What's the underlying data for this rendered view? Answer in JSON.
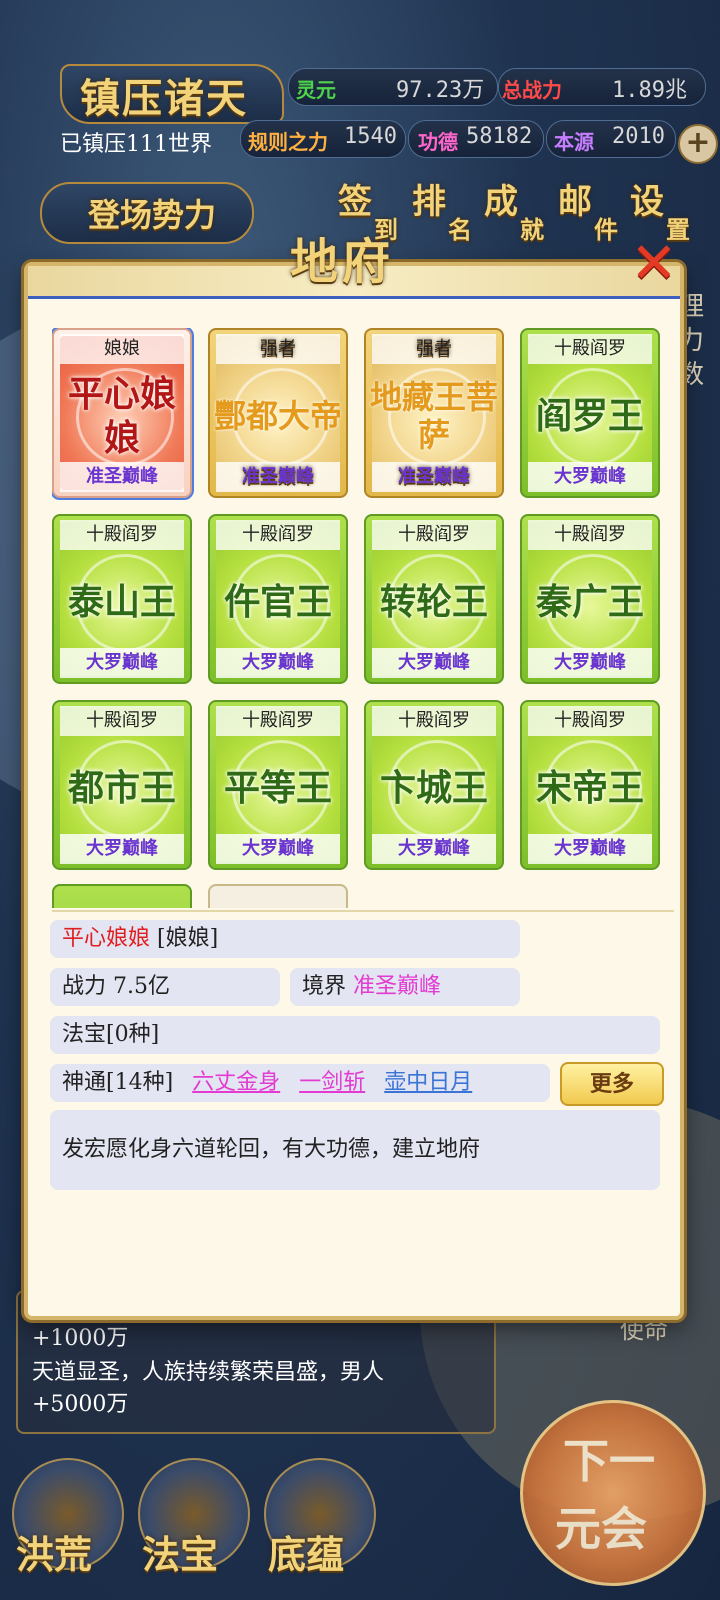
{
  "header": {
    "title": "镇压诸天",
    "world_status": "已镇压111世界",
    "resources": [
      {
        "label": "灵元",
        "value": "97.23万",
        "color": "#4fd34a"
      },
      {
        "label": "总战力",
        "value": "1.89兆",
        "color": "#ff4a4a"
      },
      {
        "label": "规则之力",
        "value": "1540",
        "color": "#ffb040"
      },
      {
        "label": "功德",
        "value": "58182",
        "color": "#ff66cc"
      },
      {
        "label": "本源",
        "value": "2010",
        "color": "#c77dff"
      }
    ],
    "plus_icon": "plus-icon",
    "faction_button": "登场势力",
    "menu": [
      {
        "big": "签",
        "small": "到"
      },
      {
        "big": "排",
        "small": "名"
      },
      {
        "big": "成",
        "small": "就"
      },
      {
        "big": "邮",
        "small": "件"
      },
      {
        "big": "设",
        "small": "置"
      }
    ]
  },
  "background_ui": {
    "side_text": "理力数",
    "log_lines": [
      "+1000万",
      "天道显圣，人族持续繁荣昌盛，男人",
      "+5000万"
    ],
    "mission_label": "使命",
    "bottom_buttons": [
      "洪荒",
      "法宝",
      "底蕴"
    ],
    "next_button": [
      "下一",
      "元会"
    ]
  },
  "modal": {
    "title": "地府",
    "close_icon": "close-x-icon",
    "cards": [
      {
        "tag": "娘娘",
        "name": "平心娘娘",
        "rank": "准圣巅峰",
        "style": "red",
        "selected": true
      },
      {
        "tag": "强者",
        "name": "酆都大帝",
        "rank": "准圣巅峰",
        "style": "gold"
      },
      {
        "tag": "强者",
        "name": "地藏王菩萨",
        "rank": "准圣巅峰",
        "style": "gold"
      },
      {
        "tag": "十殿阎罗",
        "name": "阎罗王",
        "rank": "大罗巅峰",
        "style": "green"
      },
      {
        "tag": "十殿阎罗",
        "name": "泰山王",
        "rank": "大罗巅峰",
        "style": "green"
      },
      {
        "tag": "十殿阎罗",
        "name": "仵官王",
        "rank": "大罗巅峰",
        "style": "green"
      },
      {
        "tag": "十殿阎罗",
        "name": "转轮王",
        "rank": "大罗巅峰",
        "style": "green"
      },
      {
        "tag": "十殿阎罗",
        "name": "秦广王",
        "rank": "大罗巅峰",
        "style": "green"
      },
      {
        "tag": "十殿阎罗",
        "name": "都市王",
        "rank": "大罗巅峰",
        "style": "green"
      },
      {
        "tag": "十殿阎罗",
        "name": "平等王",
        "rank": "大罗巅峰",
        "style": "green"
      },
      {
        "tag": "十殿阎罗",
        "name": "卞城王",
        "rank": "大罗巅峰",
        "style": "green"
      },
      {
        "tag": "十殿阎罗",
        "name": "宋帝王",
        "rank": "大罗巅峰",
        "style": "green"
      }
    ],
    "detail": {
      "name": "平心娘娘",
      "tag": "[娘娘]",
      "power_label": "战力",
      "power_value": "7.5亿",
      "realm_label": "境界",
      "realm_value": "准圣巅峰",
      "treasure": "法宝[0种]",
      "skills_label": "神通[14种]",
      "skills": [
        "六丈金身",
        "一剑斩",
        "壶中日月"
      ],
      "more_button": "更多",
      "description": "发宏愿化身六道轮回，有大功德，建立地府"
    }
  }
}
